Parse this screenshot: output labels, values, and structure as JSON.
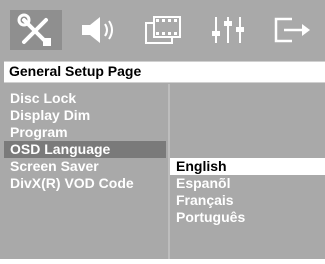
{
  "tabs": [
    {
      "name": "general-setup-icon",
      "active": true
    },
    {
      "name": "audio-setup-icon",
      "active": false
    },
    {
      "name": "video-setup-icon",
      "active": false
    },
    {
      "name": "preference-setup-icon",
      "active": false
    },
    {
      "name": "exit-icon",
      "active": false
    }
  ],
  "page": {
    "title": "General Setup Page"
  },
  "menu": {
    "items": [
      {
        "label": "Disc Lock"
      },
      {
        "label": "Display Dim"
      },
      {
        "label": "Program"
      },
      {
        "label": "OSD Language"
      },
      {
        "label": "Screen Saver"
      },
      {
        "label": "DivX(R) VOD Code"
      }
    ],
    "selected": "OSD Language"
  },
  "options": {
    "items": [
      {
        "label": "English"
      },
      {
        "label": "Espanõl"
      },
      {
        "label": "Français"
      },
      {
        "label": "Português"
      }
    ],
    "highlighted": "English"
  },
  "colors": {
    "background": "#a9a9a9",
    "selected_row": "#7a7a7a",
    "highlight_row": "#ffffff",
    "text": "#ffffff"
  }
}
